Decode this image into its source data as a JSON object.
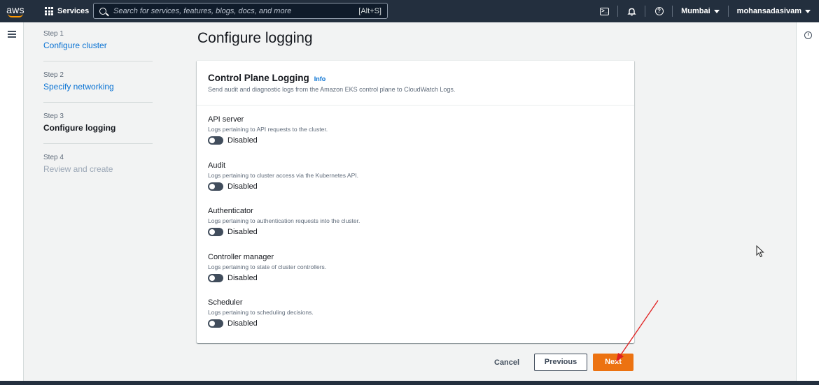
{
  "topbar": {
    "logo_text": "aws",
    "services_label": "Services",
    "search_placeholder": "Search for services, features, blogs, docs, and more",
    "search_shortcut": "[Alt+S]",
    "cloudshell_glyph": ">_",
    "help_glyph": "?",
    "region": "Mumbai",
    "user": "mohansadasivam"
  },
  "steps": [
    {
      "num": "Step 1",
      "name": "Configure cluster",
      "state": "link"
    },
    {
      "num": "Step 2",
      "name": "Specify networking",
      "state": "link"
    },
    {
      "num": "Step 3",
      "name": "Configure logging",
      "state": "active"
    },
    {
      "num": "Step 4",
      "name": "Review and create",
      "state": "disabled"
    }
  ],
  "page": {
    "title": "Configure logging"
  },
  "panel": {
    "title": "Control Plane Logging",
    "info_link": "Info",
    "description": "Send audit and diagnostic logs from the Amazon EKS control plane to CloudWatch Logs.",
    "items": [
      {
        "label": "API server",
        "desc": "Logs pertaining to API requests to the cluster.",
        "status": "Disabled"
      },
      {
        "label": "Audit",
        "desc": "Logs pertaining to cluster access via the Kubernetes API.",
        "status": "Disabled"
      },
      {
        "label": "Authenticator",
        "desc": "Logs pertaining to authentication requests into the cluster.",
        "status": "Disabled"
      },
      {
        "label": "Controller manager",
        "desc": "Logs pertaining to state of cluster controllers.",
        "status": "Disabled"
      },
      {
        "label": "Scheduler",
        "desc": "Logs pertaining to scheduling decisions.",
        "status": "Disabled"
      }
    ]
  },
  "footer": {
    "cancel": "Cancel",
    "previous": "Previous",
    "next": "Next"
  },
  "colors": {
    "nav_bg": "#232f3e",
    "primary_button": "#ec7211",
    "link": "#0972d3",
    "annotation_arrow": "#e02020"
  },
  "icons": {
    "menu": "hamburger-icon",
    "search": "search-icon",
    "cloudshell": "cloudshell-icon",
    "notifications": "bell-icon",
    "help": "help-icon",
    "info": "info-icon"
  }
}
